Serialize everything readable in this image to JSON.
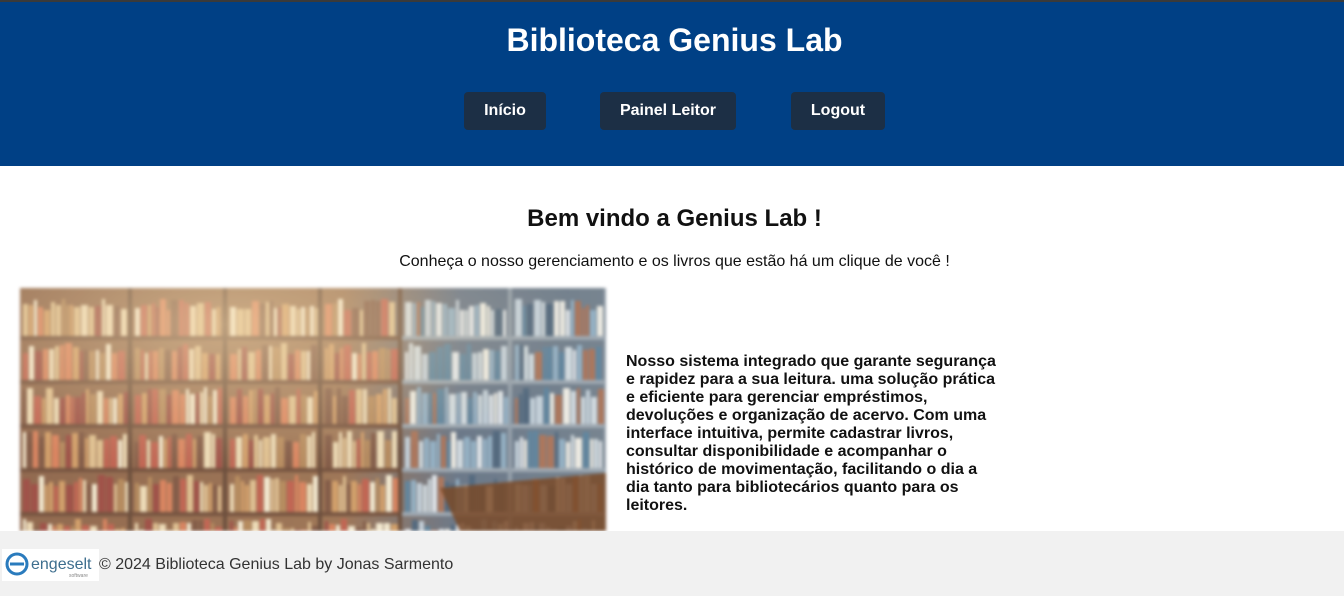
{
  "header": {
    "title": "Biblioteca Genius Lab",
    "nav": [
      {
        "label": "Início"
      },
      {
        "label": "Painel Leitor"
      },
      {
        "label": "Logout"
      }
    ]
  },
  "main": {
    "welcome": "Bem vindo a Genius Lab !",
    "subtitle": "Conheça o nosso gerenciamento e os livros que estão há um clique de você !",
    "description": "Nosso sistema integrado que garante segurança e rapidez para a sua leitura. uma solução prática e eficiente para gerenciar empréstimos, devoluções e organização de acervo. Com uma interface intuitiva, permite cadastrar livros, consultar disponibilidade e acompanhar o histórico de movimentação, facilitando o dia a dia tanto para bibliotecários quanto para os leitores.",
    "image_icon": "library-bookshelf-image"
  },
  "footer": {
    "logo_text": "engeselt",
    "logo_subtext": "software",
    "text": "© 2024 Biblioteca Genius Lab by Jonas Sarmento"
  },
  "colors": {
    "header_bg": "#004085",
    "nav_button_bg": "#1c2f45",
    "footer_bg": "#f1f1f1",
    "logo_accent": "#2a7bbd"
  }
}
